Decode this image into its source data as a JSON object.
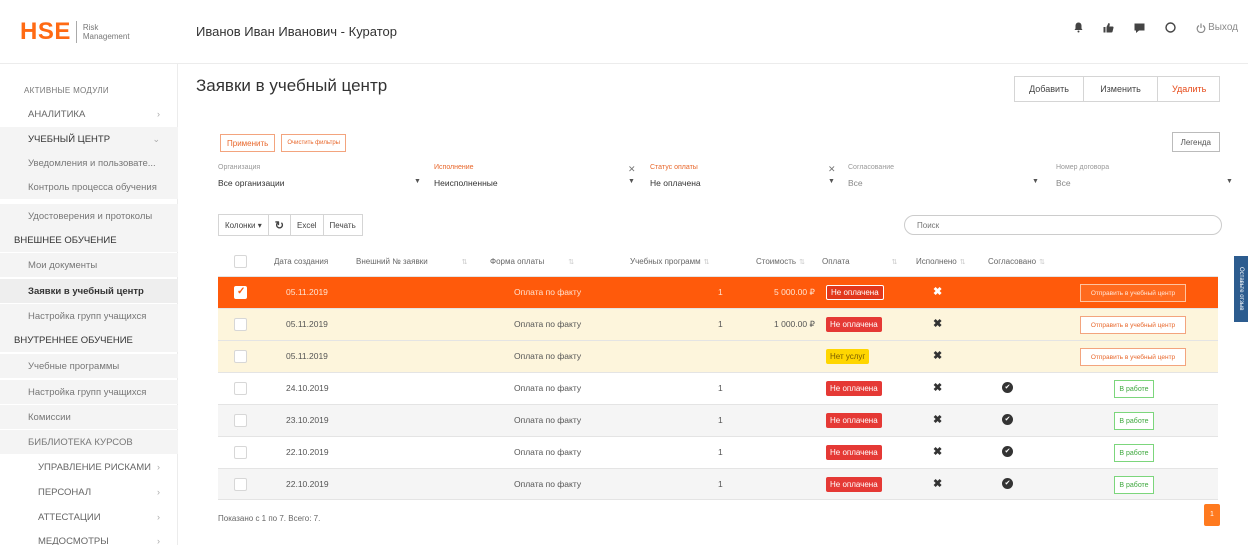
{
  "logo": {
    "brand": "HSE",
    "line1": "Risk",
    "line2": "Management"
  },
  "header": {
    "user_title": "Иванов Иван Иванович - Куратор",
    "logout_label": "Выход"
  },
  "sidebar": {
    "section_title": "АКТИВНЫЕ МОДУЛИ",
    "items": [
      {
        "label": "АНАЛИТИКА",
        "chevron": "›"
      },
      {
        "label": "УЧЕБНЫЙ ЦЕНТР",
        "chevron": "⌄"
      },
      {
        "label": "Уведомления и пользовате..."
      },
      {
        "label": "Контроль процесса обучения"
      },
      {
        "label": "Удостоверения и протоколы"
      },
      {
        "label": "ВНЕШНЕЕ ОБУЧЕНИЕ"
      },
      {
        "label": "Мои документы"
      },
      {
        "label": "Заявки в учебный центр"
      },
      {
        "label": "Настройка групп учащихся"
      },
      {
        "label": "ВНУТРЕННЕЕ ОБУЧЕНИЕ"
      },
      {
        "label": "Учебные программы"
      },
      {
        "label": "Настройка групп учащихся"
      },
      {
        "label": "Комиссии"
      },
      {
        "label": "БИБЛИОТЕКА КУРСОВ"
      },
      {
        "label": "УПРАВЛЕНИЕ РИСКАМИ",
        "chevron": "›"
      },
      {
        "label": "ПЕРСОНАЛ",
        "chevron": "›"
      },
      {
        "label": "АТТЕСТАЦИИ",
        "chevron": "›"
      },
      {
        "label": "МЕДОСМОТРЫ",
        "chevron": "›"
      }
    ]
  },
  "page": {
    "title": "Заявки в учебный центр",
    "add_label": "Добавить",
    "edit_label": "Изменить",
    "delete_label": "Удалить"
  },
  "filters": {
    "apply_label": "Применить",
    "clear_label": "Очистить фильтры",
    "legend_label": "Легенда",
    "fields": [
      {
        "label": "Организация",
        "value": "Все организации"
      },
      {
        "label": "Исполнение",
        "value": "Неисполненные"
      },
      {
        "label": "Статус оплаты",
        "value": "Не оплачена"
      },
      {
        "label": "Согласование",
        "value": "Все"
      },
      {
        "label": "Номер договора",
        "value": "Все"
      }
    ]
  },
  "toolbar": {
    "columns_label": "Колонки ▾",
    "refresh_glyph": "↻",
    "excel_label": "Excel",
    "print_label": "Печать",
    "search_placeholder": "Поиск"
  },
  "table": {
    "columns": [
      "Дата создания",
      "Внешний № заявки",
      "Форма оплаты",
      "Учебных программ",
      "Стоимость",
      "Оплата",
      "Исполнено",
      "Согласовано"
    ],
    "rows": [
      {
        "date": "05.11.2019",
        "payment_form": "Оплата по факту",
        "programs": "1",
        "cost": "5 000.00 ₽",
        "status": "Не оплачена",
        "status_color": "#e53935",
        "done": "✖",
        "agreed": "",
        "action": "Отправить в учебный центр",
        "checked": true
      },
      {
        "date": "05.11.2019",
        "payment_form": "Оплата по факту",
        "programs": "1",
        "cost": "1 000.00 ₽",
        "status": "Не оплачена",
        "status_color": "#e53935",
        "done": "✖",
        "agreed": "",
        "action": "Отправить в учебный центр",
        "checked": false
      },
      {
        "date": "05.11.2019",
        "payment_form": "Оплата по факту",
        "programs": "",
        "cost": "",
        "status": "Нет услуг",
        "status_color": "#ffd600",
        "done": "✖",
        "agreed": "",
        "action": "Отправить в учебный центр",
        "checked": false
      },
      {
        "date": "24.10.2019",
        "payment_form": "Оплата по факту",
        "programs": "1",
        "cost": "",
        "status": "Не оплачена",
        "status_color": "#e53935",
        "done": "✖",
        "agreed": "✔",
        "action": "В работе",
        "checked": false
      },
      {
        "date": "23.10.2019",
        "payment_form": "Оплата по факту",
        "programs": "1",
        "cost": "",
        "status": "Не оплачена",
        "status_color": "#e53935",
        "done": "✖",
        "agreed": "✔",
        "action": "В работе",
        "checked": false
      },
      {
        "date": "22.10.2019",
        "payment_form": "Оплата по факту",
        "programs": "1",
        "cost": "",
        "status": "Не оплачена",
        "status_color": "#e53935",
        "done": "✖",
        "agreed": "✔",
        "action": "В работе",
        "checked": false
      },
      {
        "date": "22.10.2019",
        "payment_form": "Оплата по факту",
        "programs": "1",
        "cost": "",
        "status": "Не оплачена",
        "status_color": "#e53935",
        "done": "✖",
        "agreed": "✔",
        "action": "В работе",
        "checked": false
      }
    ]
  },
  "footer": {
    "summary": "Показано с 1 по 7. Всего: 7.",
    "page": "1"
  },
  "feedback": {
    "label": "Оставьте отзыв"
  },
  "colors": {
    "accent": "#ff6a13",
    "selected_row": "#ff5a0b",
    "highlight_row": "#fdf5dc"
  },
  "icons": [
    "bell-icon",
    "thumbs-up-icon",
    "chat-icon",
    "help-icon",
    "power-icon"
  ]
}
